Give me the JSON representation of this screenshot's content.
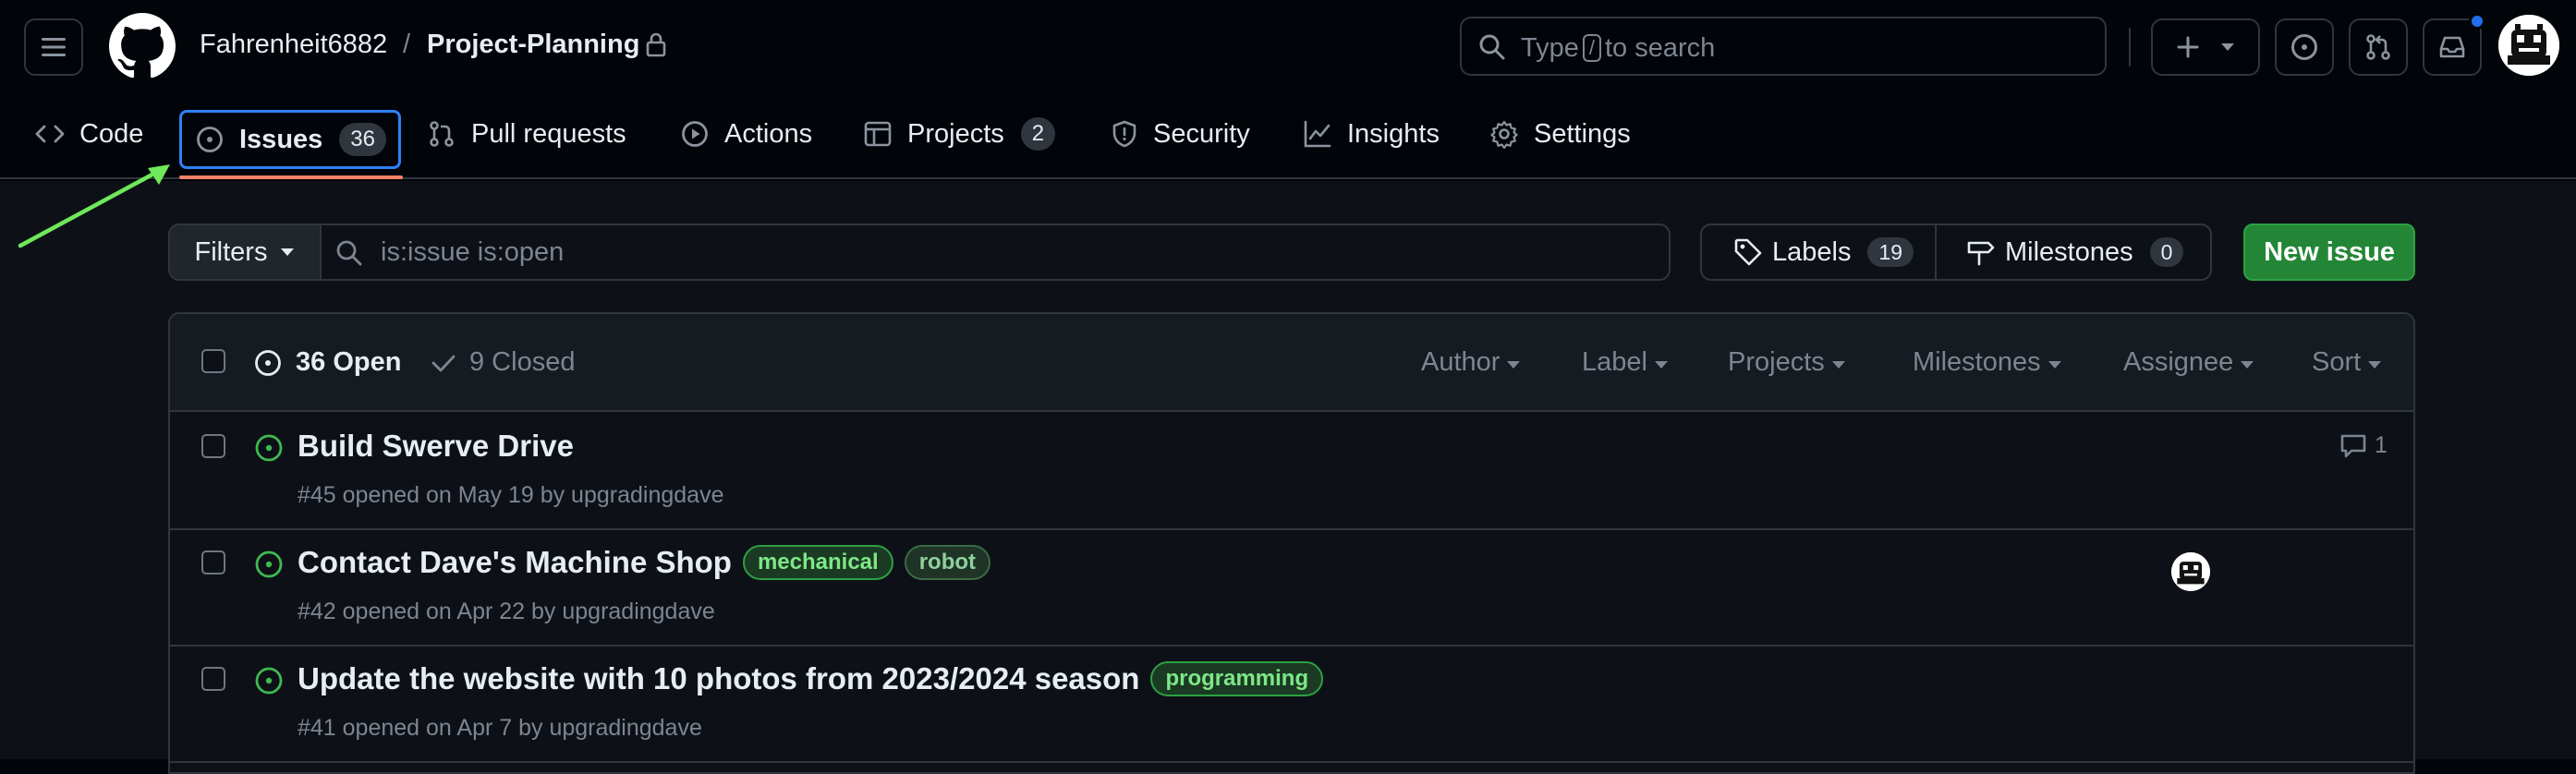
{
  "repo": {
    "owner": "Fahrenheit6882",
    "separator": "/",
    "name": "Project-Planning"
  },
  "search": {
    "prefix": "Type",
    "key": "/",
    "suffix": "to search"
  },
  "tabs": [
    {
      "label": "Code"
    },
    {
      "label": "Issues",
      "count": "36"
    },
    {
      "label": "Pull requests"
    },
    {
      "label": "Actions"
    },
    {
      "label": "Projects",
      "count": "2"
    },
    {
      "label": "Security"
    },
    {
      "label": "Insights"
    },
    {
      "label": "Settings"
    }
  ],
  "toolbar": {
    "filters_label": "Filters",
    "filter_query": "is:issue is:open",
    "labels_label": "Labels",
    "labels_count": "19",
    "milestones_label": "Milestones",
    "milestones_count": "0",
    "new_issue_label": "New issue"
  },
  "list_header": {
    "open_label": "36 Open",
    "closed_label": "9 Closed",
    "filters": [
      "Author",
      "Label",
      "Projects",
      "Milestones",
      "Assignee",
      "Sort"
    ]
  },
  "issues": [
    {
      "title": "Build Swerve Drive",
      "meta": "#45 opened on May 19 by upgradingdave",
      "labels": [],
      "comments": "1"
    },
    {
      "title": "Contact Dave's Machine Shop",
      "meta": "#42 opened on Apr 22 by upgradingdave",
      "labels": [
        "mechanical",
        "robot"
      ]
    },
    {
      "title": "Update the website with 10 photos from 2023/2024 season",
      "meta": "#41 opened on Apr 7 by upgradingdave",
      "labels": [
        "programming"
      ]
    }
  ],
  "colors": {
    "accent": "#2f81f7",
    "tab_underline": "#f78166",
    "open_icon": "#3fb950",
    "new_issue_bg": "#238636",
    "annotation_arrow": "#6fe85a"
  }
}
